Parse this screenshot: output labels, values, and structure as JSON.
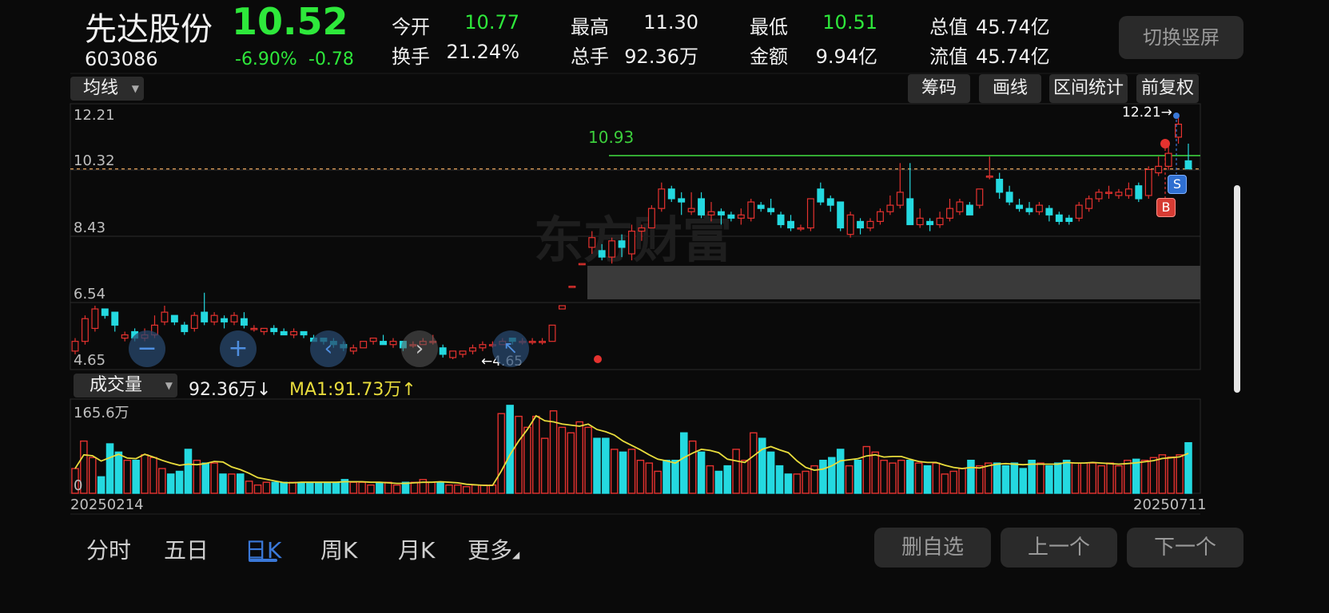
{
  "header": {
    "name": "先达股份",
    "price": "10.52",
    "code": "603086",
    "change_pct": "-6.90%",
    "change_amt": "-0.78",
    "stats": [
      {
        "label": "今开",
        "value": "10.77",
        "color": "#2ee83b"
      },
      {
        "label": "最高",
        "value": "11.30",
        "color": "#f0f0f0"
      },
      {
        "label": "最低",
        "value": "10.51",
        "color": "#2ee83b"
      },
      {
        "label": "总值",
        "value": "45.74亿",
        "color": "#f0f0f0"
      },
      {
        "label": "换手",
        "value": "21.24%",
        "color": "#f0f0f0"
      },
      {
        "label": "总手",
        "value": "92.36万",
        "color": "#f0f0f0"
      },
      {
        "label": "金额",
        "value": "9.94亿",
        "color": "#f0f0f0"
      },
      {
        "label": "流值",
        "value": "45.74亿",
        "color": "#f0f0f0"
      }
    ],
    "switch_label": "切换竖屏"
  },
  "toolbar": {
    "ma_label": "均线",
    "buttons": [
      "筹码",
      "画线",
      "区间统计",
      "前复权"
    ]
  },
  "chart": {
    "y_labels": [
      "12.21",
      "10.32",
      "8.43",
      "6.54",
      "4.65"
    ],
    "high_label": "10.93",
    "max_marker": "12.21→",
    "min_marker": "←4.65",
    "buy_badge": "B",
    "sell_badge": "S",
    "watermark": "东方财富"
  },
  "volume": {
    "selector_label": "成交量",
    "current": "92.36万↓",
    "ma1": "MA1:91.73万↑",
    "max_label": "165.6万",
    "zero_label": "0",
    "start_date": "20250214",
    "end_date": "20250711"
  },
  "bottom": {
    "tabs": [
      "分时",
      "五日",
      "日K",
      "周K",
      "月K",
      "更多"
    ],
    "active_tab": "日K",
    "buttons": [
      "删自选",
      "上一个",
      "下一个"
    ]
  },
  "colors": {
    "up": "#e5322f",
    "down": "#24d9e0",
    "ma": "#e8dc3c",
    "high_line": "#3ccf3c",
    "accent": "#3a78d8"
  },
  "chart_data": {
    "type": "candlestick",
    "ylim": [
      4.65,
      12.21
    ],
    "reference_lines": [
      {
        "label": "10.93",
        "value": 10.93
      },
      {
        "value": 10.52
      }
    ],
    "candles": [
      {
        "o": 4.9,
        "c": 5.2,
        "h": 5.3,
        "l": 4.8
      },
      {
        "o": 5.2,
        "c": 5.9,
        "h": 6.0,
        "l": 5.1
      },
      {
        "o": 5.6,
        "c": 6.2,
        "h": 6.3,
        "l": 5.5
      },
      {
        "o": 6.2,
        "c": 6.0,
        "h": 6.2,
        "l": 5.9
      },
      {
        "o": 6.1,
        "c": 5.7,
        "h": 6.1,
        "l": 5.5
      },
      {
        "o": 5.3,
        "c": 5.4,
        "h": 5.5,
        "l": 5.2
      },
      {
        "o": 5.5,
        "c": 5.3,
        "h": 5.6,
        "l": 5.2
      },
      {
        "o": 5.3,
        "c": 5.4,
        "h": 5.6,
        "l": 5.2
      },
      {
        "o": 5.4,
        "c": 5.7,
        "h": 6.0,
        "l": 5.3
      },
      {
        "o": 5.8,
        "c": 6.1,
        "h": 6.3,
        "l": 5.7
      },
      {
        "o": 6.0,
        "c": 5.8,
        "h": 6.0,
        "l": 5.7
      },
      {
        "o": 5.7,
        "c": 5.5,
        "h": 5.8,
        "l": 5.4
      },
      {
        "o": 5.6,
        "c": 6.0,
        "h": 6.1,
        "l": 5.5
      },
      {
        "o": 6.1,
        "c": 5.8,
        "h": 6.7,
        "l": 5.7
      },
      {
        "o": 5.8,
        "c": 6.0,
        "h": 6.1,
        "l": 5.7
      },
      {
        "o": 5.9,
        "c": 5.8,
        "h": 6.0,
        "l": 5.6
      },
      {
        "o": 5.8,
        "c": 6.0,
        "h": 6.1,
        "l": 5.7
      },
      {
        "o": 5.9,
        "c": 5.7,
        "h": 6.1,
        "l": 5.6
      },
      {
        "o": 5.6,
        "c": 5.6,
        "h": 5.7,
        "l": 5.5
      },
      {
        "o": 5.5,
        "c": 5.6,
        "h": 5.6,
        "l": 5.4
      },
      {
        "o": 5.6,
        "c": 5.5,
        "h": 5.7,
        "l": 5.4
      },
      {
        "o": 5.5,
        "c": 5.4,
        "h": 5.6,
        "l": 5.4
      },
      {
        "o": 5.4,
        "c": 5.5,
        "h": 5.6,
        "l": 5.3
      },
      {
        "o": 5.5,
        "c": 5.4,
        "h": 5.5,
        "l": 5.3
      },
      {
        "o": 5.3,
        "c": 5.2,
        "h": 5.4,
        "l": 5.2
      },
      {
        "o": 5.3,
        "c": 5.2,
        "h": 5.3,
        "l": 5.1
      },
      {
        "o": 5.2,
        "c": 5.1,
        "h": 5.3,
        "l": 5.0
      },
      {
        "o": 5.1,
        "c": 5.0,
        "h": 5.2,
        "l": 4.9
      },
      {
        "o": 4.9,
        "c": 5.0,
        "h": 5.1,
        "l": 4.8
      },
      {
        "o": 5.0,
        "c": 5.2,
        "h": 5.2,
        "l": 5.0
      },
      {
        "o": 5.2,
        "c": 5.3,
        "h": 5.3,
        "l": 5.1
      },
      {
        "o": 5.2,
        "c": 5.1,
        "h": 5.4,
        "l": 5.1
      },
      {
        "o": 5.1,
        "c": 5.2,
        "h": 5.3,
        "l": 5.0
      },
      {
        "o": 5.2,
        "c": 5.0,
        "h": 5.2,
        "l": 4.9
      },
      {
        "o": 5.1,
        "c": 5.1,
        "h": 5.2,
        "l": 5.0
      },
      {
        "o": 5.1,
        "c": 5.2,
        "h": 5.3,
        "l": 5.1
      },
      {
        "o": 5.2,
        "c": 5.2,
        "h": 5.4,
        "l": 5.1
      },
      {
        "o": 5.0,
        "c": 4.8,
        "h": 5.1,
        "l": 4.7
      },
      {
        "o": 4.7,
        "c": 4.9,
        "h": 4.9,
        "l": 4.65
      },
      {
        "o": 4.8,
        "c": 4.9,
        "h": 4.9,
        "l": 4.7
      },
      {
        "o": 4.9,
        "c": 5.0,
        "h": 5.1,
        "l": 4.8
      },
      {
        "o": 5.0,
        "c": 5.1,
        "h": 5.2,
        "l": 4.9
      },
      {
        "o": 5.1,
        "c": 5.1,
        "h": 5.2,
        "l": 5.0
      },
      {
        "o": 5.1,
        "c": 5.2,
        "h": 5.3,
        "l": 5.1
      },
      {
        "o": 5.3,
        "c": 5.2,
        "h": 5.3,
        "l": 5.1
      },
      {
        "o": 5.2,
        "c": 5.2,
        "h": 5.3,
        "l": 5.1
      },
      {
        "o": 5.2,
        "c": 5.2,
        "h": 5.3,
        "l": 5.1
      },
      {
        "o": 5.2,
        "c": 5.2,
        "h": 5.3,
        "l": 5.1
      },
      {
        "o": 5.2,
        "c": 5.7,
        "h": 5.7,
        "l": 5.2
      },
      {
        "o": 6.2,
        "c": 6.3,
        "h": 6.3,
        "l": 6.2
      },
      {
        "o": 6.9,
        "c": 6.9,
        "h": 6.9,
        "l": 6.9
      },
      {
        "o": 7.6,
        "c": 7.6,
        "h": 7.6,
        "l": 7.6
      },
      {
        "o": 8.1,
        "c": 8.4,
        "h": 8.6,
        "l": 7.9
      },
      {
        "o": 8.0,
        "c": 7.8,
        "h": 8.2,
        "l": 7.7
      },
      {
        "o": 7.8,
        "c": 8.3,
        "h": 8.4,
        "l": 7.6
      },
      {
        "o": 8.3,
        "c": 8.1,
        "h": 8.5,
        "l": 7.8
      },
      {
        "o": 7.9,
        "c": 8.6,
        "h": 8.8,
        "l": 7.7
      },
      {
        "o": 8.6,
        "c": 8.7,
        "h": 8.8,
        "l": 8.3
      },
      {
        "o": 8.7,
        "c": 9.3,
        "h": 9.4,
        "l": 8.7
      },
      {
        "o": 9.3,
        "c": 9.9,
        "h": 10.1,
        "l": 9.2
      },
      {
        "o": 9.9,
        "c": 9.6,
        "h": 10.0,
        "l": 9.5
      },
      {
        "o": 9.6,
        "c": 9.5,
        "h": 9.8,
        "l": 9.1
      },
      {
        "o": 9.2,
        "c": 9.3,
        "h": 9.8,
        "l": 9.1
      },
      {
        "o": 9.6,
        "c": 9.1,
        "h": 9.8,
        "l": 9.0
      },
      {
        "o": 9.1,
        "c": 9.2,
        "h": 9.5,
        "l": 8.9
      },
      {
        "o": 9.2,
        "c": 9.1,
        "h": 9.3,
        "l": 8.8
      },
      {
        "o": 9.1,
        "c": 9.0,
        "h": 9.2,
        "l": 8.9
      },
      {
        "o": 9.0,
        "c": 9.1,
        "h": 9.3,
        "l": 8.8
      },
      {
        "o": 9.0,
        "c": 9.5,
        "h": 9.6,
        "l": 8.9
      },
      {
        "o": 9.4,
        "c": 9.3,
        "h": 9.5,
        "l": 9.2
      },
      {
        "o": 9.3,
        "c": 9.2,
        "h": 9.6,
        "l": 9.1
      },
      {
        "o": 9.1,
        "c": 8.8,
        "h": 9.2,
        "l": 8.7
      },
      {
        "o": 8.9,
        "c": 8.7,
        "h": 9.1,
        "l": 8.6
      },
      {
        "o": 8.7,
        "c": 8.7,
        "h": 8.8,
        "l": 8.6
      },
      {
        "o": 8.7,
        "c": 9.6,
        "h": 9.6,
        "l": 8.6
      },
      {
        "o": 9.9,
        "c": 9.5,
        "h": 10.1,
        "l": 9.4
      },
      {
        "o": 9.6,
        "c": 9.4,
        "h": 9.7,
        "l": 9.2
      },
      {
        "o": 9.5,
        "c": 8.7,
        "h": 9.5,
        "l": 8.6
      },
      {
        "o": 8.5,
        "c": 9.1,
        "h": 9.2,
        "l": 8.4
      },
      {
        "o": 8.9,
        "c": 8.7,
        "h": 9.0,
        "l": 8.5
      },
      {
        "o": 8.7,
        "c": 8.9,
        "h": 9.0,
        "l": 8.6
      },
      {
        "o": 8.9,
        "c": 9.2,
        "h": 9.3,
        "l": 8.8
      },
      {
        "o": 9.2,
        "c": 9.4,
        "h": 9.7,
        "l": 9.1
      },
      {
        "o": 9.4,
        "c": 9.8,
        "h": 10.7,
        "l": 9.3
      },
      {
        "o": 9.6,
        "c": 8.8,
        "h": 10.7,
        "l": 8.8
      },
      {
        "o": 8.8,
        "c": 9.0,
        "h": 9.3,
        "l": 8.7
      },
      {
        "o": 8.9,
        "c": 8.8,
        "h": 9.0,
        "l": 8.6
      },
      {
        "o": 8.8,
        "c": 9.0,
        "h": 9.2,
        "l": 8.7
      },
      {
        "o": 9.0,
        "c": 9.3,
        "h": 9.6,
        "l": 8.9
      },
      {
        "o": 9.2,
        "c": 9.5,
        "h": 9.6,
        "l": 9.1
      },
      {
        "o": 9.4,
        "c": 9.1,
        "h": 9.5,
        "l": 9.1
      },
      {
        "o": 9.4,
        "c": 9.9,
        "h": 9.9,
        "l": 9.3
      },
      {
        "o": 10.3,
        "c": 10.3,
        "h": 10.9,
        "l": 10.2
      },
      {
        "o": 10.2,
        "c": 9.8,
        "h": 10.4,
        "l": 9.6
      },
      {
        "o": 9.8,
        "c": 9.5,
        "h": 10.0,
        "l": 9.4
      },
      {
        "o": 9.4,
        "c": 9.3,
        "h": 9.6,
        "l": 9.2
      },
      {
        "o": 9.3,
        "c": 9.2,
        "h": 9.5,
        "l": 9.1
      },
      {
        "o": 9.2,
        "c": 9.4,
        "h": 9.5,
        "l": 9.1
      },
      {
        "o": 9.3,
        "c": 9.1,
        "h": 9.4,
        "l": 8.9
      },
      {
        "o": 9.1,
        "c": 8.9,
        "h": 9.2,
        "l": 8.8
      },
      {
        "o": 9.0,
        "c": 8.9,
        "h": 9.1,
        "l": 8.8
      },
      {
        "o": 9.0,
        "c": 9.4,
        "h": 9.5,
        "l": 8.9
      },
      {
        "o": 9.3,
        "c": 9.6,
        "h": 9.7,
        "l": 9.2
      },
      {
        "o": 9.6,
        "c": 9.8,
        "h": 9.9,
        "l": 9.5
      },
      {
        "o": 9.8,
        "c": 9.8,
        "h": 10.0,
        "l": 9.6
      },
      {
        "o": 9.7,
        "c": 9.8,
        "h": 9.9,
        "l": 9.6
      },
      {
        "o": 9.7,
        "c": 9.9,
        "h": 10.1,
        "l": 9.6
      },
      {
        "o": 10.0,
        "c": 9.6,
        "h": 10.1,
        "l": 9.5
      },
      {
        "o": 9.7,
        "c": 10.5,
        "h": 10.6,
        "l": 9.6
      },
      {
        "o": 10.4,
        "c": 10.6,
        "h": 10.9,
        "l": 10.3
      },
      {
        "o": 10.6,
        "c": 11.0,
        "h": 11.3,
        "l": 10.5
      },
      {
        "o": 11.5,
        "c": 11.9,
        "h": 12.21,
        "l": 11.3
      },
      {
        "o": 10.77,
        "c": 10.52,
        "h": 11.3,
        "l": 10.51
      }
    ],
    "volume": {
      "ylim": [
        0,
        165.6
      ],
      "unit": "万",
      "values": [
        45,
        95,
        65,
        30,
        90,
        75,
        60,
        60,
        70,
        65,
        45,
        35,
        40,
        80,
        60,
        55,
        55,
        35,
        35,
        35,
        22,
        15,
        20,
        20,
        20,
        20,
        20,
        20,
        20,
        20,
        20,
        25,
        20,
        20,
        15,
        20,
        20,
        15,
        20,
        20,
        25,
        20,
        20,
        15,
        15,
        12,
        15,
        15,
        15,
        145,
        160,
        140,
        120,
        140,
        100,
        150,
        120,
        110,
        130,
        120,
        100,
        100,
        80,
        75,
        80,
        60,
        55,
        40,
        60,
        60,
        110,
        95,
        75,
        50,
        40,
        50,
        80,
        60,
        110,
        100,
        75,
        50,
        35,
        35,
        40,
        50,
        60,
        65,
        80,
        50,
        60,
        85,
        75,
        60,
        55,
        60,
        60,
        55,
        50,
        55,
        35,
        40,
        45,
        60,
        50,
        55,
        55,
        50,
        55,
        45,
        60,
        55,
        50,
        55,
        60,
        55,
        55,
        55,
        50,
        55,
        50,
        60,
        62,
        60,
        65,
        70,
        66,
        70,
        92
      ]
    }
  }
}
